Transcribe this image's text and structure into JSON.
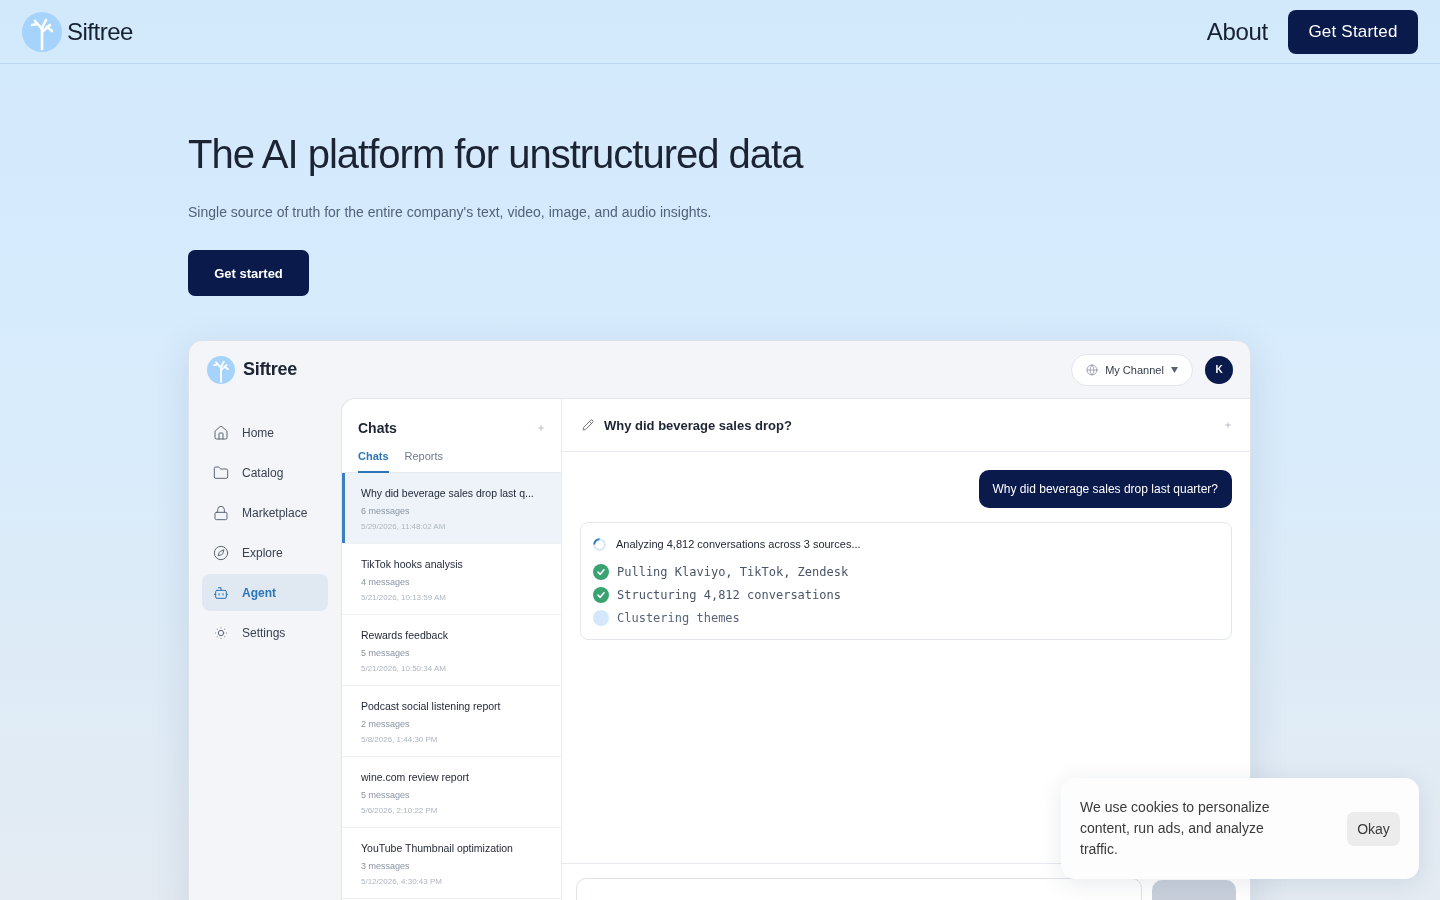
{
  "header": {
    "brand": "Siftree",
    "nav": [
      {
        "label": "About"
      }
    ],
    "cta": "Get Started"
  },
  "hero": {
    "title": "The AI platform for unstructured data",
    "subtitle": "Single source of truth for the entire company's text, video, image, and audio insights.",
    "cta": "Get started"
  },
  "app": {
    "brand": "Siftree",
    "channel": "My Channel",
    "avatar": "K",
    "sidebar": {
      "items": [
        {
          "label": "Home",
          "selected": false
        },
        {
          "label": "Catalog",
          "selected": false
        },
        {
          "label": "Marketplace",
          "selected": false
        },
        {
          "label": "Explore",
          "selected": false
        },
        {
          "label": "Agent",
          "selected": true
        },
        {
          "label": "Settings",
          "selected": false
        }
      ]
    },
    "chats": {
      "title": "Chats",
      "tabs": [
        {
          "label": "Chats",
          "selected": true
        },
        {
          "label": "Reports",
          "selected": false
        }
      ],
      "items": [
        {
          "title": "Why did beverage sales drop last q...",
          "count": "6 messages",
          "date": "5/29/2026, 11:48:02 AM",
          "selected": true
        },
        {
          "title": "TikTok hooks analysis",
          "count": "4 messages",
          "date": "5/21/2026, 10:13:59 AM",
          "selected": false
        },
        {
          "title": "Rewards feedback",
          "count": "5 messages",
          "date": "5/21/2026, 10:50:34 AM",
          "selected": false
        },
        {
          "title": "Podcast social listening report",
          "count": "2 messages",
          "date": "5/8/2026, 1:44:30 PM",
          "selected": false
        },
        {
          "title": "wine.com review report",
          "count": "5 messages",
          "date": "5/6/2026, 2:10:22 PM",
          "selected": false
        },
        {
          "title": "YouTube Thumbnail optimization",
          "count": "3 messages",
          "date": "5/12/2026, 4:30:43 PM",
          "selected": false
        }
      ]
    },
    "conversation": {
      "title": "Why did beverage sales drop?",
      "messages": [
        {
          "text": "Why did beverage sales drop last quarter?"
        }
      ],
      "status": {
        "text": "Analyzing 4,812 conversations across 3 sources...",
        "steps": [
          {
            "text": "Pulling Klaviyo, TikTok, Zendesk",
            "done": true
          },
          {
            "text": "Structuring 4,812 conversations",
            "done": true
          },
          {
            "text": "Clustering themes",
            "done": false
          }
        ]
      }
    }
  },
  "cookie_banner": {
    "text": "We use cookies to personalize content, run ads, and analyze traffic.",
    "button": "Okay"
  }
}
